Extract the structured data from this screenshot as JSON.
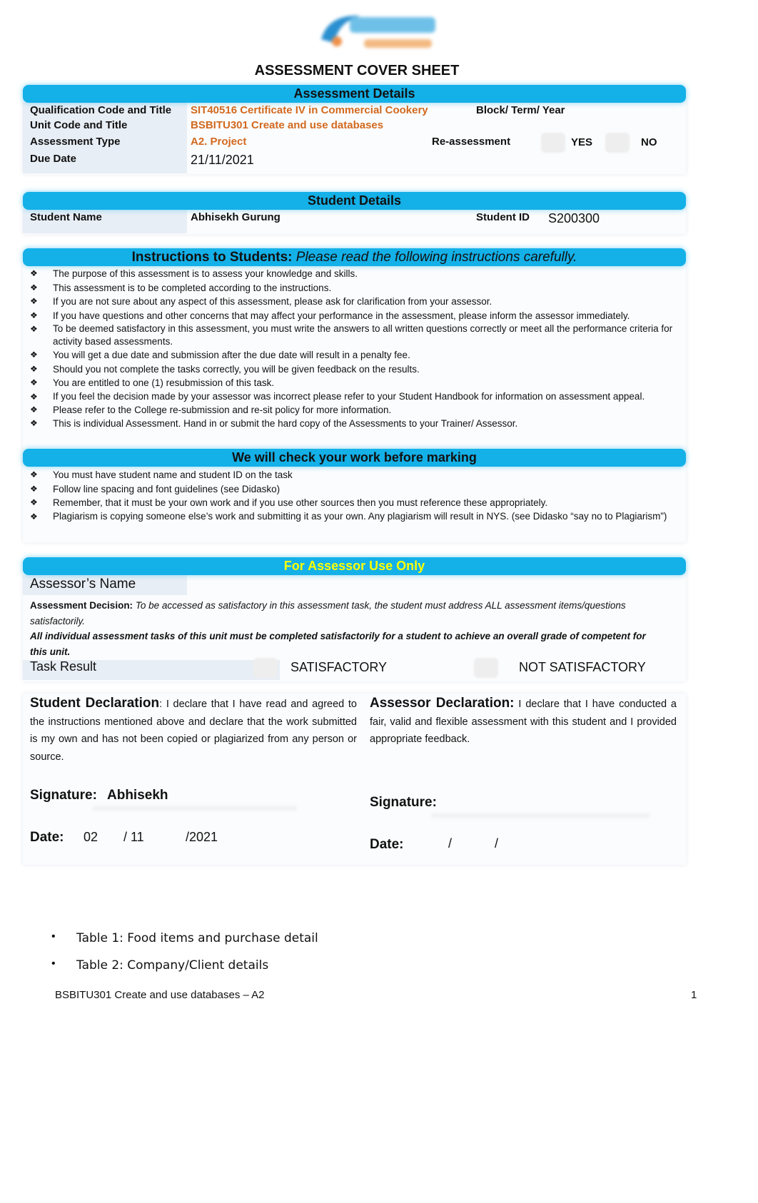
{
  "logo": {
    "text": "Skyline",
    "icon": "skyline-logo"
  },
  "title": "ASSESSMENT COVER SHEET",
  "assessment_details": {
    "heading": "Assessment Details",
    "qualification_label": "Qualification Code and Title",
    "qualification_value": "SIT40516 Certificate IV in Commercial Cookery",
    "block_label": "Block/ Term/ Year",
    "unit_label": "Unit Code and Title",
    "unit_value": "BSBITU301 Create and use databases",
    "type_label": "Assessment Type",
    "type_value": "A2. Project",
    "reassessment_label": "Re-assessment",
    "yes": "YES",
    "no": "NO",
    "due_label": "Due Date",
    "due_value": "21/11/2021"
  },
  "student_details": {
    "heading": "Student Details",
    "name_label": "Student Name",
    "name_value": "Abhisekh Gurung",
    "id_label": "Student ID",
    "id_value": "S200300"
  },
  "instructions": {
    "heading_bold": "Instructions to Students:",
    "heading_italic": "Please read the following instructions carefully.",
    "items": [
      "The purpose of this assessment is to assess your knowledge and skills.",
      "This assessment is to be completed according to the instructions.",
      "If you are not sure about any aspect of this assessment, please ask for clarification from your assessor.",
      "If you have questions and other concerns that may affect your performance in the assessment, please inform the assessor immediately.",
      "To be deemed satisfactory in this assessment, you must write the answers to all written questions correctly or meet all the performance criteria for activity based assessments.",
      "You will get a due date and submission after the due date will result in a penalty fee.",
      "Should you not complete the tasks correctly, you will be given feedback on the results.",
      "You are entitled to one (1) resubmission of this task.",
      "If you feel the decision made by your assessor was incorrect please refer to your Student Handbook for information on assessment appeal.",
      "Please refer to the College re-submission and re-sit policy for more information.",
      "This is individual Assessment. Hand in or submit the hard copy of the Assessments to your Trainer/ Assessor."
    ]
  },
  "check": {
    "heading": "We will check your work before marking",
    "items": [
      "You must have student name and student ID on the task",
      "Follow line spacing and font guidelines (see Didasko)",
      "Remember, that it must be your own work and if you use other sources then you must reference these appropriately.",
      "Plagiarism is copying someone else’s work and submitting it as your own. Any plagiarism will result in NYS. (see Didasko “say no to Plagiarism”)"
    ]
  },
  "assessor": {
    "heading": "For Assessor Use Only",
    "name_label": "Assessor’s Name",
    "decision_label": "Assessment Decision:",
    "decision_text": "To be accessed as satisfactory in this assessment task, the student must address ALL assessment items/questions satisfactorily.",
    "decision_note": "All individual assessment tasks of this unit must be completed satisfactorily for a student to achieve an overall grade of competent for this unit.",
    "task_result_label": "Task Result",
    "satisfactory": "SATISFACTORY",
    "not_satisfactory": "NOT SATISFACTORY"
  },
  "student_declaration": {
    "heading": "Student Declaration",
    "text": ": I declare that I have read and agreed to the instructions mentioned above and declare that the work submitted is my own and has not been copied or plagiarized from any person or source.",
    "signature_label": "Signature:",
    "signature_value": "Abhisekh",
    "date_label": "Date:",
    "day": "02",
    "month": "/ 11",
    "year": "/2021"
  },
  "assessor_declaration": {
    "heading": "Assessor Declaration:",
    "text": " I declare that I have conducted a fair, valid and flexible assessment with this student and I provided appropriate feedback.",
    "signature_label": "Signature:",
    "date_label": "Date:",
    "sep1": "/",
    "sep2": "/"
  },
  "bullets": [
    "Table 1: Food items and purchase detail",
    "Table 2: Company/Client details"
  ],
  "footer": {
    "left": "BSBITU301 Create and use databases – A2",
    "page": "1"
  },
  "colors": {
    "bar": "#14b0e8",
    "orange": "#d2691e",
    "yellow": "#ffff00"
  }
}
